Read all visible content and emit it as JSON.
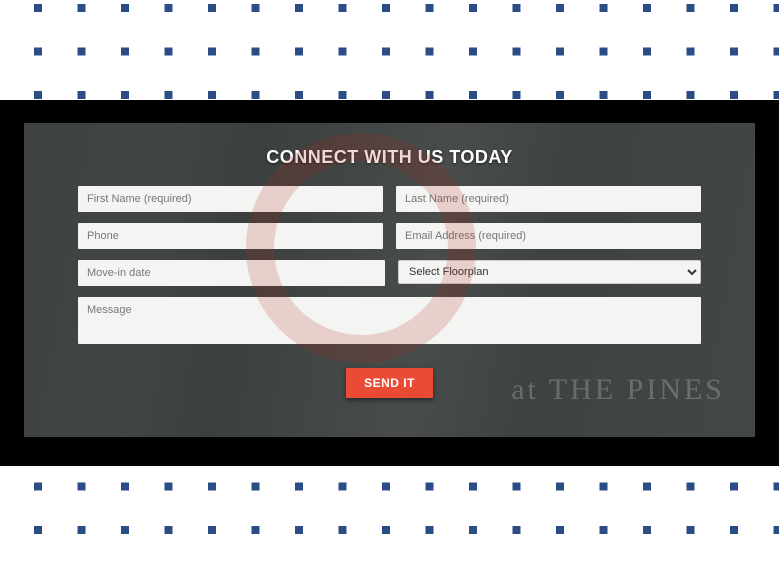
{
  "colors": {
    "dot": "#2b4d86",
    "button_bg": "#e94b35"
  },
  "form": {
    "heading": "CONNECT WITH US TODAY",
    "first_name_ph": "First Name (required)",
    "last_name_ph": "Last Name (required)",
    "phone_ph": "Phone",
    "email_ph": "Email Address (required)",
    "movein_ph": "Move-in date",
    "floorplan_selected": "Select Floorplan",
    "message_ph": "Message",
    "submit_label": "SEND IT"
  },
  "background": {
    "ghost_text": "at THE PINES"
  }
}
